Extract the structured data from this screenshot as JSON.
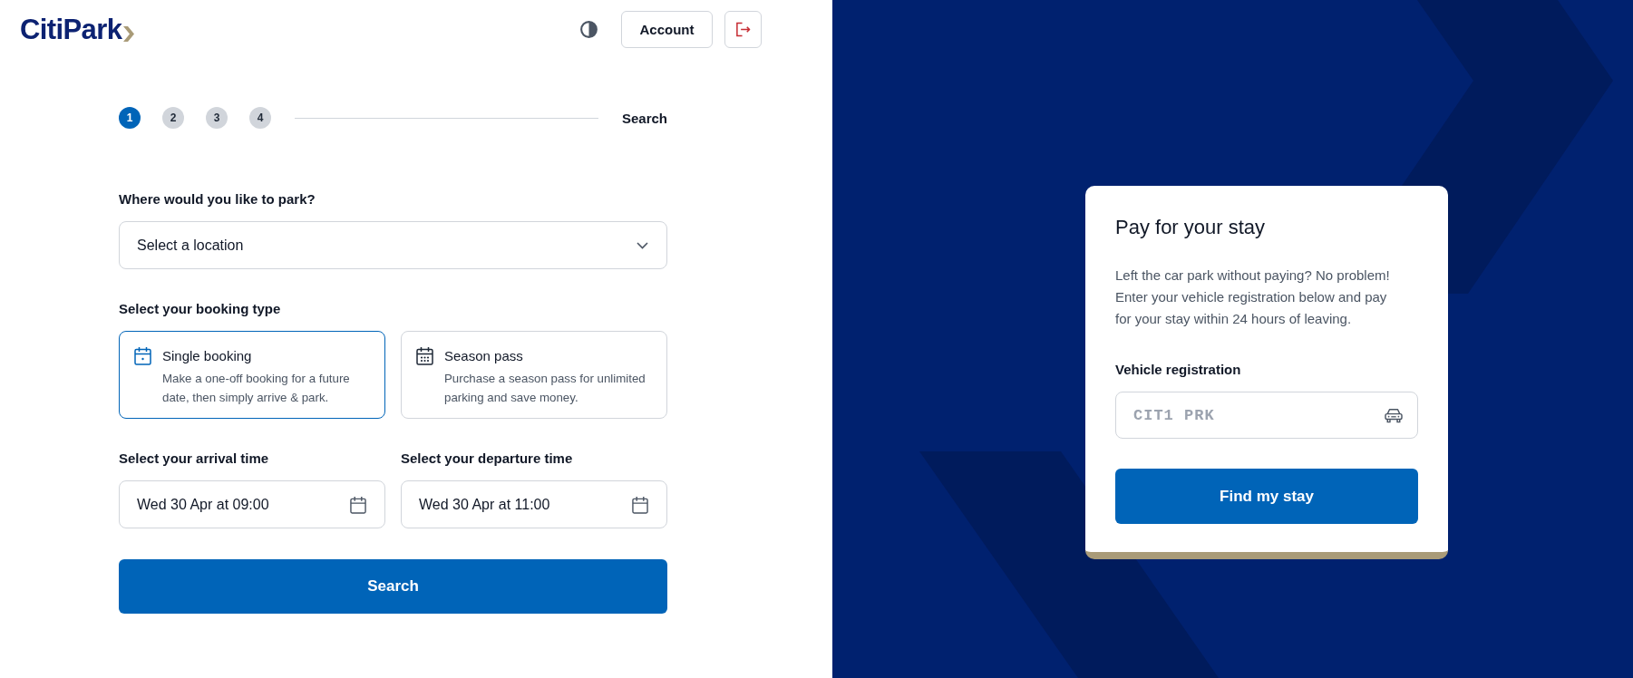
{
  "header": {
    "logo": "CitiPark",
    "account_button": "Account"
  },
  "stepper": {
    "steps": [
      {
        "label": "1",
        "selected": true
      },
      {
        "label": "2",
        "selected": false
      },
      {
        "label": "3",
        "selected": false
      },
      {
        "label": "4",
        "selected": false
      }
    ],
    "current_step_title": "Search"
  },
  "booking_form": {
    "location": {
      "label": "Where would you like to park?",
      "placeholder": "Select a location"
    },
    "booking_type": {
      "label": "Select your booking type",
      "options": [
        {
          "kind": "single",
          "title": "Single booking",
          "description": "Make a one-off booking for a future date, then simply arrive & park.",
          "selected": true
        },
        {
          "kind": "season",
          "title": "Season pass",
          "description": "Purchase a season pass for unlimited parking and save money.",
          "selected": false
        }
      ]
    },
    "times": [
      {
        "label": "Select your arrival time",
        "value": "Wed 30 Apr at 09:00"
      },
      {
        "label": "Select your departure time",
        "value": "Wed 30 Apr at 11:00"
      }
    ],
    "submit_button": "Search"
  },
  "pay_card": {
    "title": "Pay for your stay",
    "description": "Left the car park without paying? No problem! Enter your vehicle registration below and pay for your stay within 24 hours of leaving.",
    "registration": {
      "label": "Vehicle registration",
      "placeholder": "CIT1 PRK"
    },
    "submit_button": "Find my stay"
  }
}
